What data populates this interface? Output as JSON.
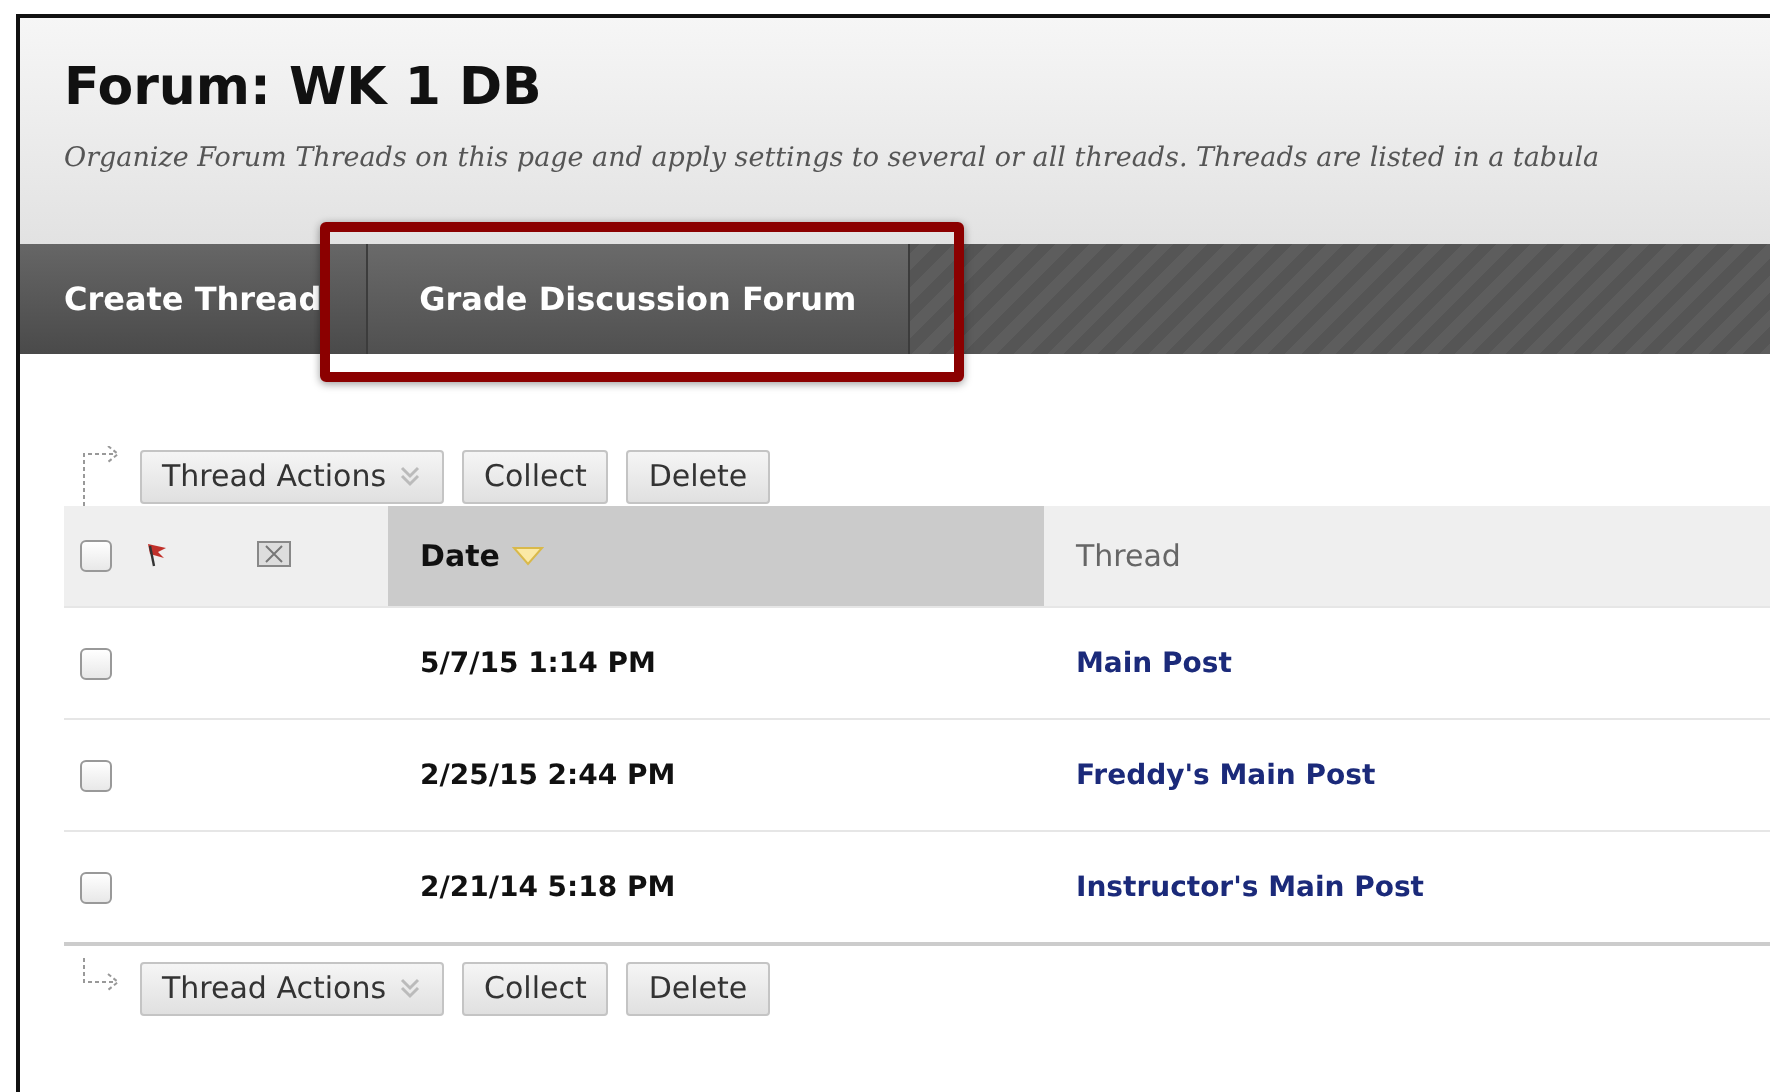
{
  "page_title": "Forum: WK 1 DB",
  "description": "Organize Forum Threads on this page and apply settings to several or all threads. Threads are listed in a tabula",
  "nav": [
    {
      "label": "Create Thread",
      "annotated": false
    },
    {
      "label": "Grade Discussion Forum",
      "annotated": true
    }
  ],
  "top_actions": [
    {
      "label": "Thread Actions",
      "kind": "dropdown"
    },
    {
      "label": "Collect",
      "kind": "plain"
    },
    {
      "label": "Delete",
      "kind": "plain"
    }
  ],
  "table": {
    "select_all": {
      "checked": false
    },
    "columns": [
      {
        "label": "Date",
        "sorted": true
      },
      {
        "label": "Thread",
        "sorted": false
      }
    ],
    "rows": [
      {
        "checked": false,
        "date": "5/7/15 1:14 PM",
        "thread": "Main Post"
      },
      {
        "checked": false,
        "date": "2/25/15 2:44 PM",
        "thread": "Freddy's Main Post"
      },
      {
        "checked": false,
        "date": "2/21/14 5:18 PM",
        "thread": "Instructor's Main Post"
      }
    ]
  },
  "bottom_actions": [
    {
      "label": "Thread Actions",
      "kind": "dropdown"
    },
    {
      "label": "Collect",
      "kind": "plain"
    },
    {
      "label": "Delete",
      "kind": "plain"
    }
  ]
}
